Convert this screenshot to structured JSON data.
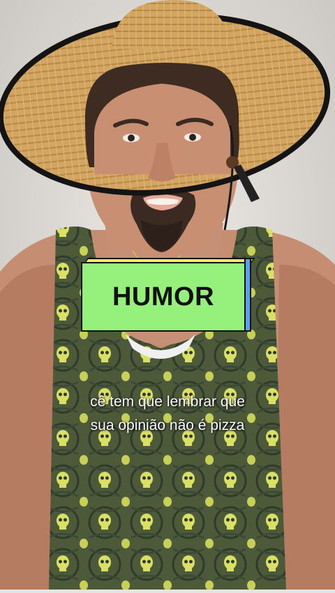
{
  "overlay": {
    "badge_text": "HUMOR",
    "badge_colors": {
      "face": "#95f07c",
      "top": "#f4ec60",
      "side": "#5aa0f0"
    }
  },
  "caption": {
    "line1": "cê tem que lembrar que",
    "line2": "sua opinião não é pizza"
  },
  "scene": {
    "subject": "man-with-straw-hat-and-skull-print-tank-top"
  }
}
